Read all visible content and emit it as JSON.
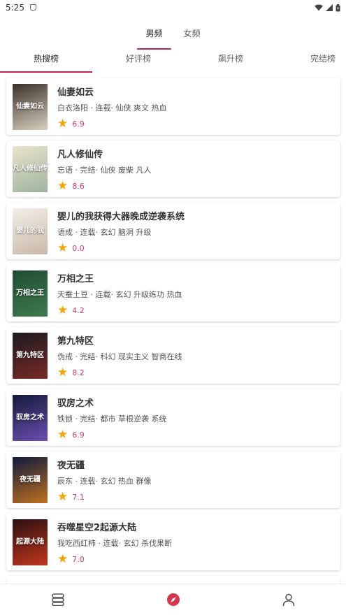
{
  "status_bar": {
    "time": "5:25"
  },
  "gender_tabs": [
    {
      "label": "男频",
      "active": true
    },
    {
      "label": "女频",
      "active": false
    }
  ],
  "rank_tabs": [
    {
      "label": "热搜榜",
      "active": true
    },
    {
      "label": "好评榜",
      "active": false
    },
    {
      "label": "飙升榜",
      "active": false
    },
    {
      "label": "完结榜",
      "active": false
    }
  ],
  "books": [
    {
      "title": "仙妻如云",
      "meta": "白衣洛阳 · 连载· 仙侠 爽文 热血",
      "score": "6.9",
      "cover_text": "仙妻如云",
      "cover_colors": [
        "#3a3028",
        "#d9cfc0"
      ]
    },
    {
      "title": "凡人修仙传",
      "meta": "忘语 · 完结· 仙侠 废柴 凡人",
      "score": "8.6",
      "cover_text": "凡人修仙传",
      "cover_colors": [
        "#e9e4cc",
        "#9fb3a0"
      ]
    },
    {
      "title": "婴儿的我获得大器晚成逆袭系统",
      "meta": "语成 · 连载· 玄幻 脑洞 升级",
      "score": "0.0",
      "cover_text": "婴儿的我",
      "cover_colors": [
        "#f2eee9",
        "#c9b8a8"
      ]
    },
    {
      "title": "万相之王",
      "meta": "天蚕土豆 · 连载· 玄幻 升级练功 热血",
      "score": "4.2",
      "cover_text": "万相之王",
      "cover_colors": [
        "#1f4d33",
        "#3f7a4e"
      ]
    },
    {
      "title": "第九特区",
      "meta": "伪戒 · 完结· 科幻 现实主义 智商在线",
      "score": "8.2",
      "cover_text": "第九特区",
      "cover_colors": [
        "#1b1a22",
        "#7a2a24"
      ]
    },
    {
      "title": "驭房之术",
      "meta": "铁锁 · 完结· 都市 草根逆袭 系统",
      "score": "6.9",
      "cover_text": "驭房之术",
      "cover_colors": [
        "#141a3a",
        "#6a4fb0"
      ]
    },
    {
      "title": "夜无疆",
      "meta": "辰东 · 连载· 玄幻 热血 群像",
      "score": "7.1",
      "cover_text": "夜无疆",
      "cover_colors": [
        "#0d1b3e",
        "#c0701e"
      ]
    },
    {
      "title": "吞噬星空2起源大陆",
      "meta": "我吃西红柿 · 连载· 玄幻 杀伐果断",
      "score": "7.0",
      "cover_text": "起源大陆",
      "cover_colors": [
        "#2a0f12",
        "#c2371c"
      ]
    }
  ],
  "bottom_nav": [
    {
      "icon": "bookshelf-icon",
      "active": false
    },
    {
      "icon": "compass-icon",
      "active": true
    },
    {
      "icon": "user-icon",
      "active": false
    }
  ],
  "colors": {
    "accent": "#b3245c",
    "star": "#f5a400",
    "score": "#d4376e"
  }
}
